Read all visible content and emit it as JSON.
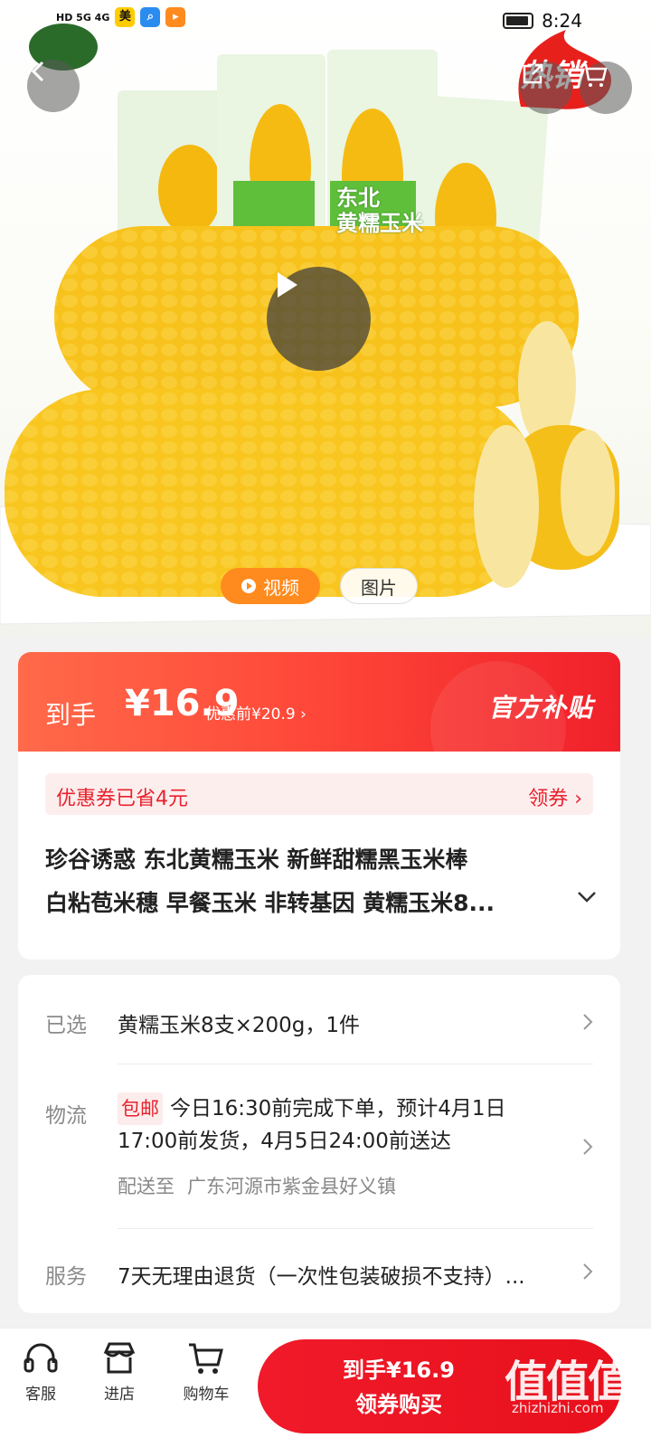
{
  "status_bar": {
    "time": "8:24",
    "left_text": "HD 5G 4G",
    "app_badge_text": "美"
  },
  "hero": {
    "hot_badge_text": "热销",
    "package_text_line1": "东北",
    "package_text_line2": "黄糯玉米",
    "media_tabs": {
      "video_label": "视频",
      "image_label": "图片"
    }
  },
  "price": {
    "label": "到手",
    "amount": "¥16.9",
    "before_label": "优惠前¥20.9 ›",
    "official_badge": "官方补贴"
  },
  "coupon": {
    "saved_text": "优惠券已省4元",
    "action_label": "领券 ›"
  },
  "product": {
    "title_line1": "珍谷诱惑 东北黄糯玉米 新鲜甜糯黑玉米棒",
    "title_line2": "白粘苞米穗 早餐玉米 非转基因 黄糯玉米8..."
  },
  "spec": {
    "selected_label": "已选",
    "selected_value": "黄糯玉米8支×200g，1件",
    "logistics_label": "物流",
    "free_shipping_tag": "包邮",
    "delivery_line1": "今日16:30前完成下单，预计4月1日",
    "delivery_line2": "17:00前发货，4月5日24:00前送达",
    "ship_to_label": "配送至",
    "ship_to_address": "广东河源市紫金县好义镇",
    "service_label": "服务",
    "service_value": "7天无理由退货（一次性包装破损不支持）..."
  },
  "bottom_bar": {
    "customer_service_label": "客服",
    "store_label": "进店",
    "cart_label": "购物车",
    "buy_line1": "到手¥16.9",
    "buy_line2": "领券购买"
  },
  "watermark": {
    "text": "值值值",
    "url": "zhizhizhi.com"
  },
  "colors": {
    "accent_red": "#e8222d",
    "video_tab_orange": "#ff8a1e",
    "corn_yellow": "#f6c21a",
    "pack_green": "#5fbf3a"
  },
  "icons": [
    "back-arrow-icon",
    "share-icon",
    "cart-icon",
    "play-icon",
    "headset-icon",
    "store-icon",
    "chevron-right-icon",
    "chevron-down-icon"
  ]
}
